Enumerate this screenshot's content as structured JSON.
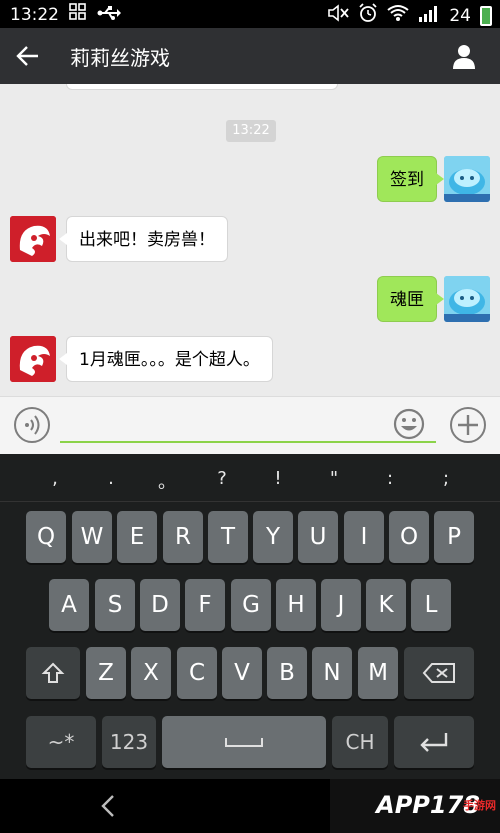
{
  "status_bar": {
    "time": "13:22",
    "battery": "24"
  },
  "header": {
    "title": "莉莉丝游戏"
  },
  "chat": {
    "timestamp": "13:22",
    "messages": [
      {
        "side": "out",
        "text": "签到"
      },
      {
        "side": "in",
        "text": "出来吧！卖房兽！"
      },
      {
        "side": "out",
        "text": "魂匣"
      },
      {
        "side": "in",
        "text": "1月魂匣。。。是个超人。"
      }
    ]
  },
  "input": {
    "placeholder": ""
  },
  "keyboard": {
    "punctuation": [
      ",",
      ".",
      "。",
      "?",
      "!",
      "\"",
      ":",
      ";"
    ],
    "row1": [
      "Q",
      "W",
      "E",
      "R",
      "T",
      "Y",
      "U",
      "I",
      "O",
      "P"
    ],
    "row2": [
      "A",
      "S",
      "D",
      "F",
      "G",
      "H",
      "J",
      "K",
      "L"
    ],
    "row3": [
      "Z",
      "X",
      "C",
      "V",
      "B",
      "N",
      "M"
    ],
    "symbols_label": "~*",
    "numbers_label": "123",
    "language_label": "CH"
  },
  "watermark": {
    "text": "APP178",
    "sub": "手游网"
  },
  "colors": {
    "header_bg": "#2f3033",
    "bubble_out": "#a0e75a",
    "bubble_in": "#ffffff",
    "chat_bg": "#ebebeb",
    "keyboard_bg": "#1d1f1f",
    "key_bg": "#6a6f72",
    "input_underline": "#8bd34a"
  }
}
